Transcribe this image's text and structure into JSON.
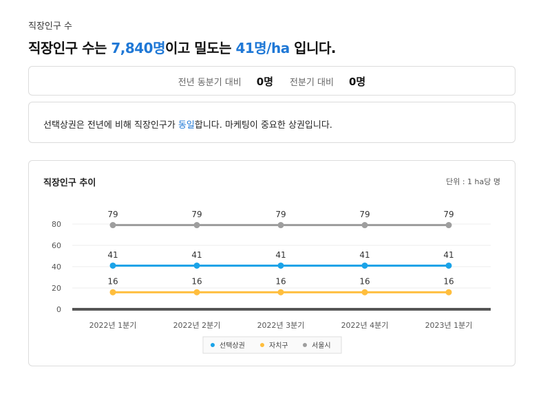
{
  "header": {
    "section_label": "직장인구 수",
    "headline_prefix": "직장인구 수는 ",
    "headline_count": "7,840명",
    "headline_mid": "이고 밀도는 ",
    "headline_density": "41명/ha",
    "headline_suffix": " 입니다."
  },
  "compare": {
    "yoy_label": "전년 동분기 대비",
    "yoy_value": "0명",
    "qoq_label": "전분기 대비",
    "qoq_value": "0명"
  },
  "summary": {
    "prefix": "선택상권은 전년에 비해 직장인구가 ",
    "highlight": "동일",
    "suffix": "합니다. 마케팅이 중요한 상권입니다."
  },
  "colors": {
    "accent": "#1f78d6",
    "series_selected": "#1aa3e8",
    "series_district": "#ffbe3d",
    "series_seoul": "#9e9e9e"
  },
  "chart_meta": {
    "title": "직장인구 추이",
    "unit": "단위 : 1 ha당 명"
  },
  "chart_data": {
    "type": "line",
    "categories": [
      "2022년 1분기",
      "2022년 2분기",
      "2022년 3분기",
      "2022년 4분기",
      "2023년 1분기"
    ],
    "series": [
      {
        "name": "선택상권",
        "values": [
          41,
          41,
          41,
          41,
          41
        ],
        "color": "#1aa3e8"
      },
      {
        "name": "자치구",
        "values": [
          16,
          16,
          16,
          16,
          16
        ],
        "color": "#ffbe3d"
      },
      {
        "name": "서울시",
        "values": [
          79,
          79,
          79,
          79,
          79
        ],
        "color": "#9e9e9e"
      }
    ],
    "yticks": [
      0,
      20,
      40,
      60,
      80
    ],
    "ylim": [
      0,
      80
    ],
    "grid": true,
    "data_labels": true,
    "legend_position": "bottom-center"
  }
}
